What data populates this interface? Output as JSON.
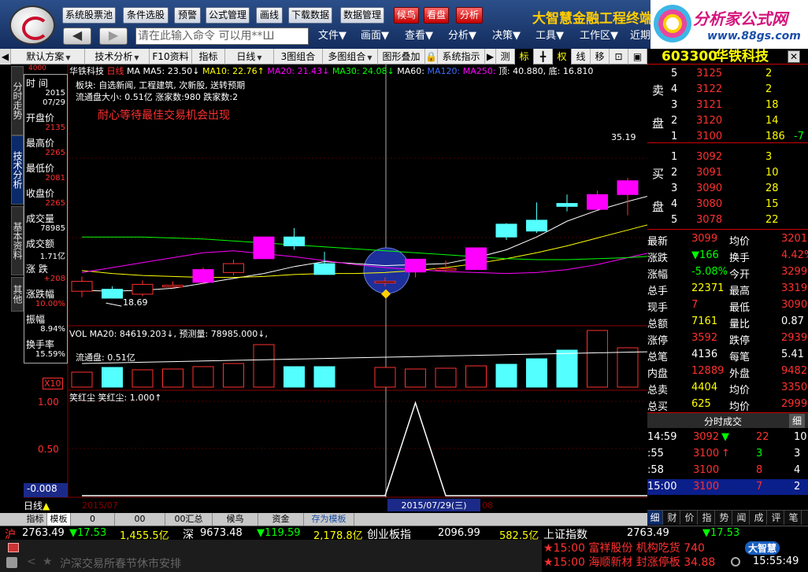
{
  "topbar": {
    "buttons": [
      "系统股票池",
      "条件选股",
      "预警",
      "公式管理",
      "画线",
      "下载数据",
      "数据管理"
    ],
    "red_buttons": [
      "候鸟",
      "看盘",
      "分析"
    ],
    "ad_title": "大智慧金融工程终端",
    "command_placeholder": "请在此输入命令  可以用**Ш",
    "menus": [
      "文件▼",
      "画面▼",
      "查看▼",
      "分析▼",
      "决策▼",
      "工具▼",
      "工作区▼",
      "近期"
    ],
    "back_icon": "◀",
    "fwd_icon": "▶"
  },
  "ad": {
    "name": "分析家公式网",
    "url": "www.88gs.com"
  },
  "toolbar2": {
    "items": [
      "默认方案",
      "技术分析",
      "F10资料",
      "指标",
      "日线",
      "3图组合",
      "多图组合",
      "图形叠加",
      "系统指示",
      "测",
      "标",
      "权",
      "线",
      "移"
    ]
  },
  "stock": {
    "code": "603300",
    "name": "华铁科技"
  },
  "side_tabs": [
    "分时走势",
    "技术分析",
    "基本资料",
    "其他"
  ],
  "infobox": {
    "rows": [
      {
        "label": "时 间",
        "value": "2015\n07/29"
      },
      {
        "label": "开盘价",
        "value": "2135"
      },
      {
        "label": "最高价",
        "value": "2265"
      },
      {
        "label": "最低价",
        "value": "2081"
      },
      {
        "label": "收盘价",
        "value": "2265"
      },
      {
        "label": "成交量",
        "value": "78985"
      },
      {
        "label": "成交额",
        "value": "1.71亿"
      },
      {
        "label": "涨 跌",
        "value": "+208"
      },
      {
        "label": "涨跌幅",
        "value": "10.00%"
      },
      {
        "label": "振幅",
        "value": "8.94%"
      },
      {
        "label": "换手率",
        "value": "15.59%"
      }
    ]
  },
  "chart": {
    "header": "华铁科技",
    "period": "日线",
    "ma_prefix": "MA",
    "ma_label": "MA5:",
    "ma5": "23.50↓",
    "ma10": "MA10: 22.76↑",
    "ma20": "MA20: 21.43↓",
    "ma30": "MA30: 24.08↓",
    "ma60": "MA60: ",
    "ma120": "MA120: ",
    "ma250": "MA250: ",
    "top_label": "顶: 40.880,",
    "bottom_label": "底: 16.810",
    "info1": "板块: 自选新闻, 工程建筑, 次新股, 送转预期",
    "info2": "流通盘大小: 0.51亿   涨家数:980   跌家数:2",
    "slogan": "耐心等待最佳交易机会出现",
    "high_mark": "35.19",
    "low_mark": "18.69",
    "price_top_scale": "4000",
    "vol_header": "VOL MA20: 84619.203↓, 预测量: 78985.000↓,",
    "vol_sub": "流通盘: 0.51亿",
    "vol_scale": "X10",
    "ind_header": "笑红尘 笑红尘: 1.000↑",
    "ind_scale": [
      "1.00",
      "0.50"
    ],
    "ind_value": "-0.008",
    "xaxis": [
      "2015/07",
      "2015/07/29(三)",
      "08"
    ],
    "period_label": "日线"
  },
  "chart_data": {
    "type": "candlestick",
    "candles": [
      {
        "o": 19.4,
        "c": 20.4,
        "h": 20.9,
        "l": 18.8
      },
      {
        "o": 19.6,
        "c": 18.7,
        "h": 19.9,
        "l": 18.69
      },
      {
        "o": 19.1,
        "c": 20.1,
        "h": 20.5,
        "l": 18.9
      },
      {
        "o": 20.0,
        "c": 20.0,
        "h": 20.4,
        "l": 19.7
      },
      {
        "o": 20.3,
        "c": 21.6,
        "h": 21.8,
        "l": 20.1
      },
      {
        "o": 21.3,
        "c": 22.2,
        "h": 22.6,
        "l": 21.0
      },
      {
        "o": 22.7,
        "c": 24.9,
        "h": 24.9,
        "l": 22.7
      },
      {
        "o": 24.9,
        "c": 24.0,
        "h": 25.8,
        "l": 23.6
      },
      {
        "o": 22.2,
        "c": 21.1,
        "h": 23.4,
        "l": 21.1
      },
      {
        "o": null,
        "c": null,
        "h": null,
        "l": null
      },
      {
        "o": 20.4,
        "c": 20.4,
        "h": 20.8,
        "l": 19.9
      },
      {
        "o": 21.35,
        "c": 22.65,
        "h": 22.65,
        "l": 20.81
      },
      {
        "o": 21.6,
        "c": 21.7,
        "h": 22.5,
        "l": 21.4
      },
      {
        "o": 21.6,
        "c": 23.8,
        "h": 23.8,
        "l": 21.6
      },
      {
        "o": 26.2,
        "c": 24.9,
        "h": 26.3,
        "l": 24.6
      },
      {
        "o": 26.6,
        "c": 25.5,
        "h": 28.4,
        "l": 25.3
      },
      {
        "o": 28.3,
        "c": 28.0,
        "h": 29.2,
        "l": 27.5
      },
      {
        "o": 27.7,
        "c": 29.2,
        "h": 29.6,
        "l": 27.7
      },
      {
        "o": 29.2,
        "c": 30.6,
        "h": 30.9,
        "l": 27.1
      },
      {
        "o": 32.5,
        "c": 30.4,
        "h": 35.19,
        "l": 30.0
      },
      {
        "o": 31.6,
        "c": 32.3,
        "h": 33.4,
        "l": 31.0
      }
    ],
    "volume": [
      19,
      25,
      22,
      23,
      26,
      30,
      54,
      26,
      26,
      null,
      25,
      23,
      24,
      27,
      29,
      36,
      47,
      72,
      50,
      55,
      64
    ],
    "ma5": [
      19.5,
      19.4,
      19.5,
      19.7,
      20.2,
      20.7,
      21.2,
      21.9,
      22.4,
      22.2,
      22.0,
      22.1,
      22.2,
      22.8,
      23.6,
      24.9,
      26.5,
      27.6,
      28.5,
      29.3,
      30.0
    ],
    "ma10": [
      21.5,
      21.2,
      21.0,
      20.9,
      20.8,
      20.8,
      20.9,
      21.1,
      21.2,
      21.2,
      21.3,
      21.5,
      21.8,
      22.2,
      22.7,
      23.3,
      24.0,
      24.8,
      25.6,
      26.4,
      27.2
    ],
    "ma20": [
      21.3,
      21.8,
      22.3,
      22.8,
      23.3,
      23.5,
      23.2,
      22.9,
      22.5,
      22.1,
      21.8,
      21.6,
      21.4,
      21.3,
      21.2,
      21.3,
      21.6,
      22.1,
      22.8,
      23.5,
      24.2
    ],
    "ma30": [
      24.9,
      24.9,
      24.9,
      24.8,
      24.7,
      24.5,
      24.3,
      24.1,
      23.9,
      23.7,
      23.5,
      23.3,
      23.1,
      22.9,
      22.7,
      22.6,
      22.6,
      22.7,
      22.8,
      23.0,
      23.3
    ],
    "indicator": [
      0,
      0,
      0,
      0,
      0,
      0,
      0,
      0,
      0,
      0,
      0,
      1,
      0,
      0,
      0,
      0,
      0,
      0,
      0,
      0,
      0
    ],
    "ylim": [
      16.81,
      40.88
    ]
  },
  "orderbook": {
    "sell": [
      {
        "lvl": "5",
        "price": "3125",
        "vol": "2"
      },
      {
        "lvl": "4",
        "price": "3122",
        "vol": "2"
      },
      {
        "lvl": "3",
        "price": "3121",
        "vol": "18"
      },
      {
        "lvl": "2",
        "price": "3120",
        "vol": "14"
      },
      {
        "lvl": "1",
        "price": "3100",
        "vol": "186",
        "extra": "-7"
      }
    ],
    "buy": [
      {
        "lvl": "1",
        "price": "3092",
        "vol": "3"
      },
      {
        "lvl": "2",
        "price": "3091",
        "vol": "10"
      },
      {
        "lvl": "3",
        "price": "3090",
        "vol": "28"
      },
      {
        "lvl": "4",
        "price": "3080",
        "vol": "15"
      },
      {
        "lvl": "5",
        "price": "3078",
        "vol": "22"
      }
    ],
    "sell_label": [
      "卖",
      "盘"
    ],
    "buy_label": [
      "买",
      "盘"
    ]
  },
  "quote": [
    {
      "l1": "最新",
      "v1": "3099",
      "l2": "均价",
      "v2": "3201"
    },
    {
      "l1": "涨跌",
      "v1": "▼166",
      "l2": "换手",
      "v2": "4.42%"
    },
    {
      "l1": "涨幅",
      "v1": "-5.08%",
      "l2": "今开",
      "v2": "3299"
    },
    {
      "l1": "总手",
      "v1": "22371",
      "l2": "最高",
      "v2": "3319"
    },
    {
      "l1": "现手",
      "v1": "7",
      "l2": "最低",
      "v2": "3090"
    },
    {
      "l1": "总额",
      "v1": "7161",
      "l2": "量比",
      "v2": "0.87"
    },
    {
      "l1": "涨停",
      "v1": "3592",
      "l2": "跌停",
      "v2": "2939"
    },
    {
      "l1": "总笔",
      "v1": "4136",
      "l2": "每笔",
      "v2": "5.41"
    },
    {
      "l1": "内盘",
      "v1": "12889",
      "l2": "外盘",
      "v2": "9482"
    },
    {
      "l1": "总卖",
      "v1": "4404",
      "l2": "均价",
      "v2": "3350"
    },
    {
      "l1": "总买",
      "v1": "625",
      "l2": "均价",
      "v2": "2999"
    }
  ],
  "ticks": {
    "title": "分时成交",
    "btn": "细",
    "rows": [
      {
        "t": "14:59",
        "p": "3092",
        "a": "▼",
        "v": "22",
        "n": "10"
      },
      {
        "t": ":55",
        "p": "3100",
        "a": "↑",
        "v": "3",
        "n": "3"
      },
      {
        "t": ":58",
        "p": "3100",
        "a": "",
        "v": "8",
        "n": "4"
      },
      {
        "t": "15:00",
        "p": "3100",
        "a": "",
        "v": "7",
        "n": "2"
      }
    ]
  },
  "right_tabs": [
    "细",
    "财",
    "价",
    "指",
    "势",
    "闻",
    "成",
    "评",
    "笔"
  ],
  "bottom_tabs": [
    "指标",
    "模板",
    "0",
    "00",
    "00汇总",
    "候鸟",
    "资金",
    "存为模板"
  ],
  "status": {
    "sh_label": "沪",
    "sh_index": "2763.49",
    "sh_chg": "▼17.53",
    "sh_amt": "1,455.5亿",
    "sz_label": "深",
    "sz_index": "9673.48",
    "sz_chg": "▼119.59",
    "sz_amt": "2,178.8亿",
    "cy_label": "创业板指",
    "cy_index": "2096.99",
    "cy_amt": "582.5亿",
    "sh2_label": "上证指数",
    "sh2_index": "2763.49",
    "sh2_chg": "▼17.53"
  },
  "ticker": {
    "news": "沪深交易所春节休市安排",
    "alert1": "★15:00 富祥股份 机构吃货 740",
    "alert2": "★15:00 海顺新材 封涨停板 34.88",
    "brand": "大智慧",
    "clock": "15:55:49"
  }
}
